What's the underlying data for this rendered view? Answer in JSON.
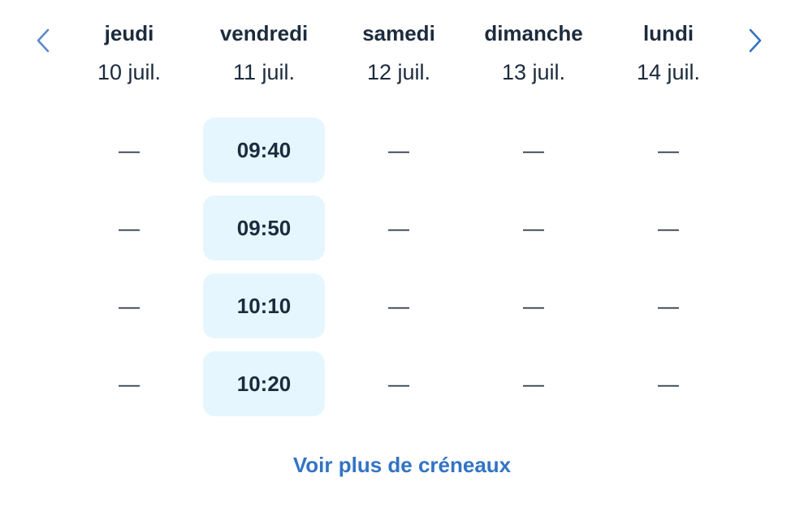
{
  "navigation": {
    "prev_icon": "chevron-left-icon",
    "next_icon": "chevron-right-icon",
    "prev_color": "#5a8ac9",
    "next_color": "#3274c4"
  },
  "days": [
    {
      "name": "jeudi",
      "date": "10 juil.",
      "slots": [
        "—",
        "—",
        "—",
        "—"
      ]
    },
    {
      "name": "vendredi",
      "date": "11 juil.",
      "slots": [
        "09:40",
        "09:50",
        "10:10",
        "10:20"
      ]
    },
    {
      "name": "samedi",
      "date": "12 juil.",
      "slots": [
        "—",
        "—",
        "—",
        "—"
      ]
    },
    {
      "name": "dimanche",
      "date": "13 juil.",
      "slots": [
        "—",
        "—",
        "—",
        "—"
      ]
    },
    {
      "name": "lundi",
      "date": "14 juil.",
      "slots": [
        "—",
        "—",
        "—",
        "—"
      ]
    }
  ],
  "footer": {
    "more_label": "Voir plus de créneaux"
  },
  "colors": {
    "slot_background": "#e6f6fe",
    "link": "#3274c4",
    "text": "#1c2b3d"
  }
}
